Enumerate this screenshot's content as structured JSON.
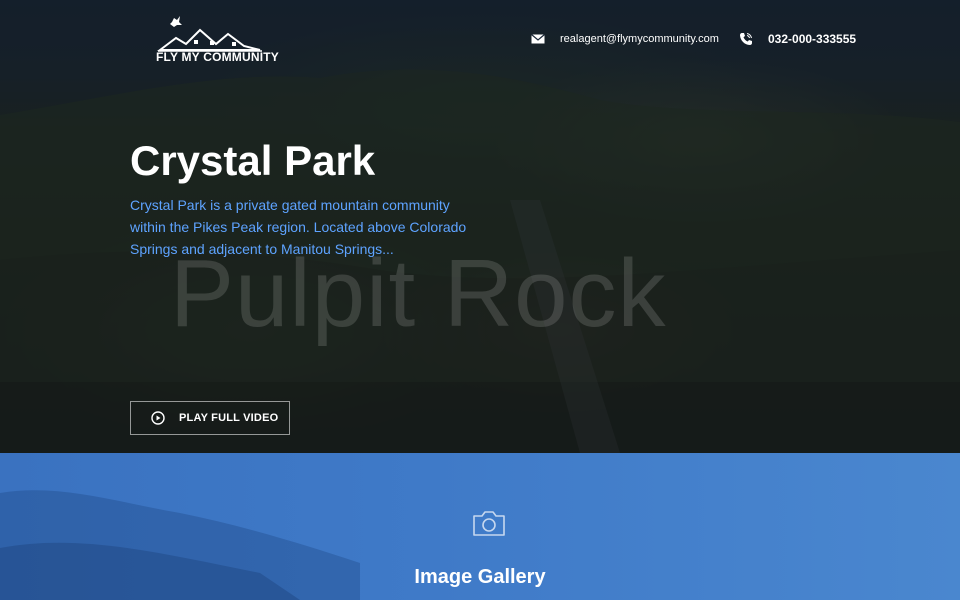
{
  "header": {
    "logo_text": "FLY MY COMMUNITY",
    "email": "realagent@flymycommunity.com",
    "phone": "032-000-333555",
    "email_icon": "envelope-icon",
    "phone_icon": "phone-icon"
  },
  "hero": {
    "title": "Crystal Park",
    "description": "Crystal Park is a private gated mountain community within the Pikes Peak region. Located above Colorado Springs and adjacent to Manitou Springs...",
    "watermark": "Pulpit Rock",
    "play_button_label": "PLAY FULL VIDEO",
    "play_icon": "play-circle-icon"
  },
  "gallery": {
    "title": "Image Gallery",
    "icon": "camera-icon"
  },
  "colors": {
    "accent_text": "#5ea3ff",
    "gallery_bg": "#3f7ac8",
    "hero_dark": "#1b2838"
  }
}
